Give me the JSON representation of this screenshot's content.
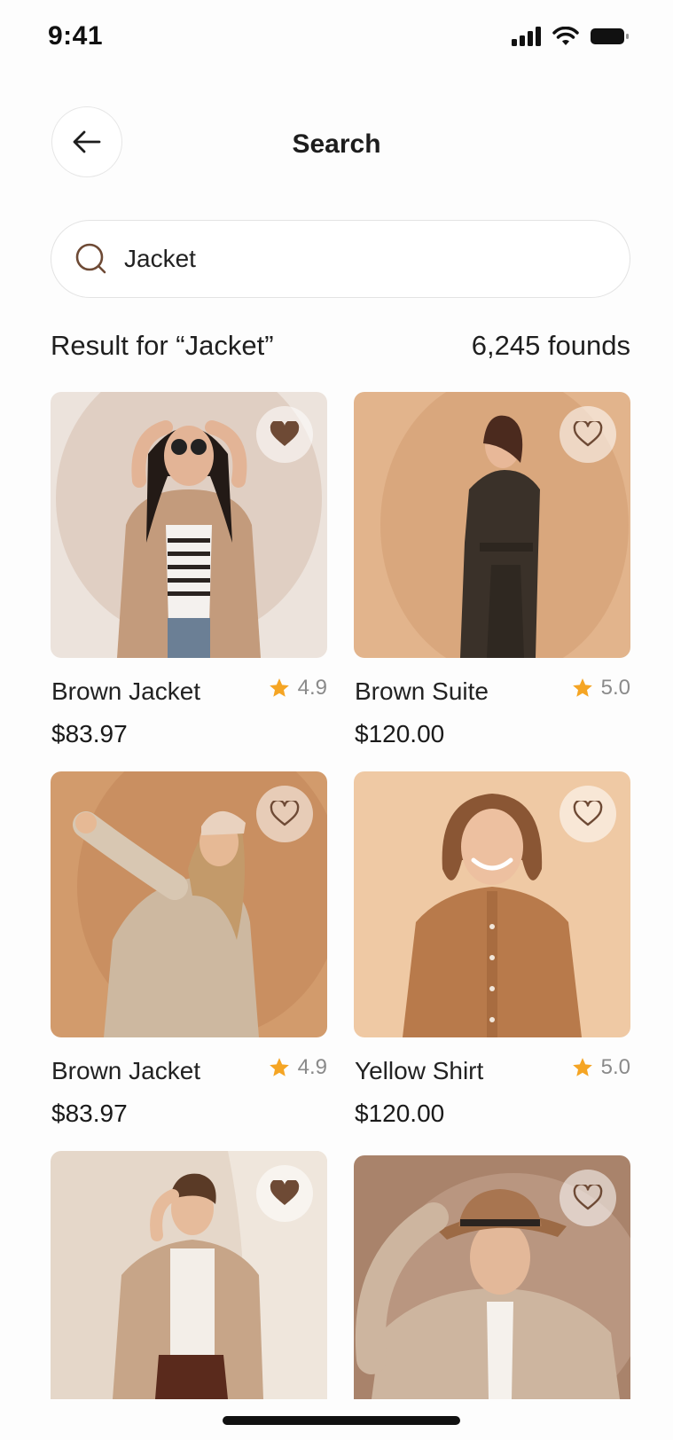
{
  "status_bar": {
    "time": "9:41"
  },
  "header": {
    "title": "Search"
  },
  "search": {
    "value": "Jacket",
    "placeholder": ""
  },
  "results": {
    "label": "Result for “Jacket”",
    "count": "6,245 founds"
  },
  "colors": {
    "accent": "#6e4a35",
    "star": "#f5a524",
    "muted": "#8a8a8a"
  },
  "products": [
    {
      "name": "Brown Jacket",
      "rating": "4.9",
      "price": "$83.97",
      "favorited": true
    },
    {
      "name": "Brown Suite",
      "rating": "5.0",
      "price": "$120.00",
      "favorited": false
    },
    {
      "name": "Brown Jacket",
      "rating": "4.9",
      "price": "$83.97",
      "favorited": false
    },
    {
      "name": "Yellow Shirt",
      "rating": "5.0",
      "price": "$120.00",
      "favorited": false
    },
    {
      "name": "",
      "rating": "",
      "price": "",
      "favorited": true
    },
    {
      "name": "",
      "rating": "",
      "price": "",
      "favorited": false
    }
  ]
}
